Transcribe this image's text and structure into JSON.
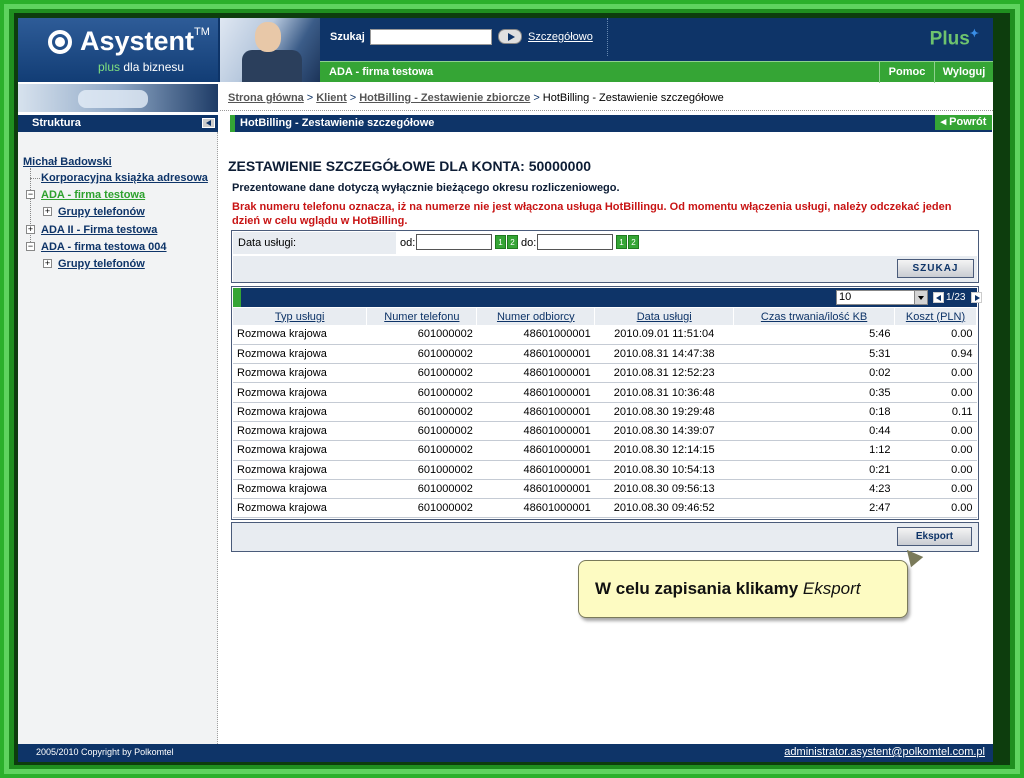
{
  "header": {
    "logo_text": "Asystent",
    "logo_tm": "TM",
    "logo_sub_plus": "plus",
    "logo_sub_rest": " dla biznesu",
    "search_label": "Szukaj",
    "search_value": "",
    "advanced_link": "Szczegółowo",
    "brand": "Plus",
    "account_title": "ADA - firma testowa",
    "help": "Pomoc",
    "logout": "Wyloguj"
  },
  "breadcrumb": {
    "items": [
      "Strona główna",
      "Klient",
      "HotBilling - Zestawienie zbiorcze"
    ],
    "current": "HotBilling - Zestawienie szczegółowe",
    "separator": ">"
  },
  "sidebar": {
    "title": "Struktura",
    "items": [
      "Michał Badowski",
      "Korporacyjna książka adresowa",
      "ADA - firma testowa",
      "Grupy telefonów",
      "ADA II - Firma testowa",
      "ADA - firma testowa 004",
      "Grupy telefonów"
    ]
  },
  "page": {
    "bar_title": "HotBilling - Zestawienie szczegółowe",
    "back": "Powrót",
    "heading": "ZESTAWIENIE SZCZEGÓŁOWE DLA KONTA: 50000000",
    "note1": "Prezentowane dane dotyczą wyłącznie bieżącego okresu rozliczeniowego.",
    "note2": "Brak numeru telefonu oznacza, iż na numerze nie jest włączona usługa HotBillingu. Od momentu włączenia usługi, należy odczekać jeden dzień w celu wglądu w HotBilling."
  },
  "filter": {
    "label": "Data usługi:",
    "from_label": "od:",
    "to_label": "do:",
    "from_value": "",
    "to_value": "",
    "cal1": "1",
    "cal2": "2",
    "search_button": "SZUKAJ"
  },
  "pager": {
    "page_size": "10",
    "page_text": "1/23"
  },
  "table": {
    "headers": [
      "Typ usługi",
      "Numer telefonu",
      "Numer odbiorcy",
      "Data usługi",
      "Czas trwania/ilość KB",
      "Koszt (PLN)"
    ],
    "rows": [
      [
        "Rozmowa krajowa",
        "601000002",
        "48601000001",
        "2010.09.01 11:51:04",
        "5:46",
        "0.00"
      ],
      [
        "Rozmowa krajowa",
        "601000002",
        "48601000001",
        "2010.08.31 14:47:38",
        "5:31",
        "0.94"
      ],
      [
        "Rozmowa krajowa",
        "601000002",
        "48601000001",
        "2010.08.31 12:52:23",
        "0:02",
        "0.00"
      ],
      [
        "Rozmowa krajowa",
        "601000002",
        "48601000001",
        "2010.08.31 10:36:48",
        "0:35",
        "0.00"
      ],
      [
        "Rozmowa krajowa",
        "601000002",
        "48601000001",
        "2010.08.30 19:29:48",
        "0:18",
        "0.11"
      ],
      [
        "Rozmowa krajowa",
        "601000002",
        "48601000001",
        "2010.08.30 14:39:07",
        "0:44",
        "0.00"
      ],
      [
        "Rozmowa krajowa",
        "601000002",
        "48601000001",
        "2010.08.30 12:14:15",
        "1:12",
        "0.00"
      ],
      [
        "Rozmowa krajowa",
        "601000002",
        "48601000001",
        "2010.08.30 10:54:13",
        "0:21",
        "0.00"
      ],
      [
        "Rozmowa krajowa",
        "601000002",
        "48601000001",
        "2010.08.30 09:56:13",
        "4:23",
        "0.00"
      ],
      [
        "Rozmowa krajowa",
        "601000002",
        "48601000001",
        "2010.08.30 09:46:52",
        "2:47",
        "0.00"
      ]
    ]
  },
  "export_button": "Eksport",
  "callout": {
    "text": "W celu zapisania klikamy ",
    "emphasis": "Eksport"
  },
  "footer": {
    "copyright": "2005/2010 Copyright by Polkomtel",
    "email": "administrator.asystent@polkomtel.com.pl"
  },
  "colors": {
    "navy": "#0e3468",
    "green": "#35a535",
    "frame": "#2bb02b",
    "warning": "#c81414"
  }
}
